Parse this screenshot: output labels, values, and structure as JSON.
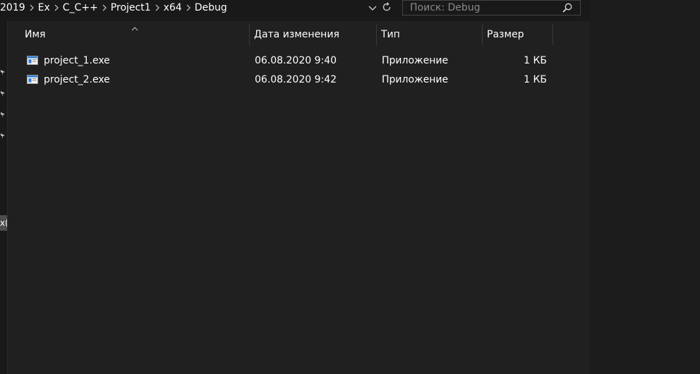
{
  "breadcrumb": {
    "items": [
      "2019",
      "Ex",
      "C_C++",
      "Project1",
      "x64",
      "Debug"
    ]
  },
  "search": {
    "placeholder": "Поиск: Debug",
    "value": ""
  },
  "nav": {
    "cut_item_label": "x("
  },
  "columns": {
    "name": "Имя",
    "date": "Дата изменения",
    "type": "Тип",
    "size": "Размер"
  },
  "files": [
    {
      "name": "project_1.exe",
      "date": "06.08.2020 9:40",
      "type": "Приложение",
      "size": "1 КБ",
      "icon": "exe-file-icon"
    },
    {
      "name": "project_2.exe",
      "date": "06.08.2020 9:42",
      "type": "Приложение",
      "size": "1 КБ",
      "icon": "exe-file-icon"
    }
  ],
  "colors": {
    "background": "#202020",
    "bar": "#191919",
    "text": "#ffffff",
    "icon_blue": "#2f7dd6"
  }
}
